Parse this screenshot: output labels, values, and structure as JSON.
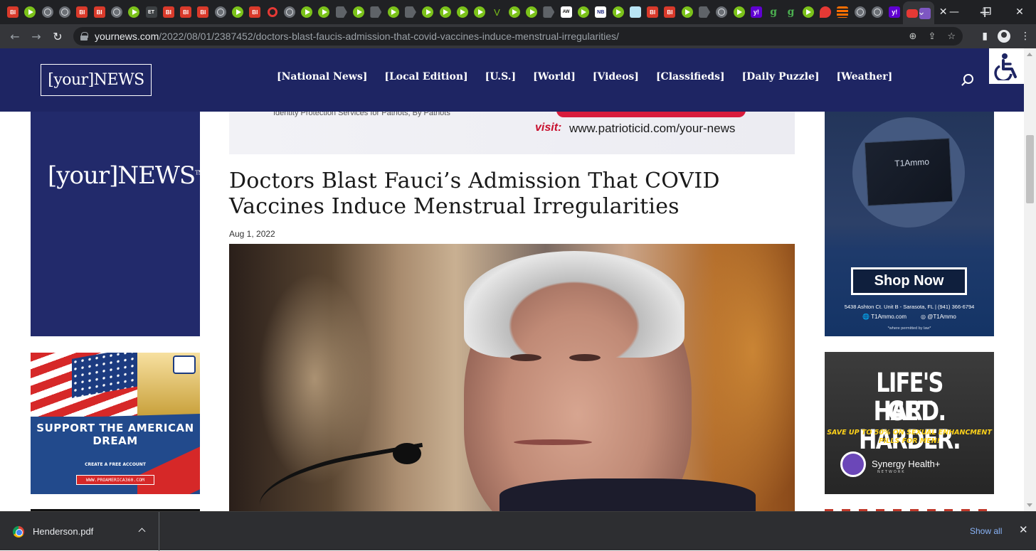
{
  "browser": {
    "tab_favicons": [
      "BI",
      "play",
      "globe",
      "globe",
      "BI",
      "BI",
      "globe",
      "play",
      "ET",
      "BI",
      "BI",
      "BI",
      "globe",
      "play",
      "BI",
      "red-circle",
      "globe",
      "play",
      "play",
      "flag",
      "play",
      "flag",
      "play",
      "flag",
      "play",
      "play",
      "play",
      "play",
      "V",
      "play",
      "play",
      "flag",
      "dark",
      "play",
      "NB",
      "play",
      "grid",
      "BI",
      "BI",
      "play",
      "flag",
      "globe",
      "play",
      "Y",
      "g",
      "g",
      "play",
      "pin",
      "stack",
      "globe",
      "globe",
      "Y"
    ],
    "active_tab_icons": [
      "youtube-icon",
      "mail-icon"
    ],
    "new_tab_label": "+",
    "url_host": "yournews.com",
    "url_path": "/2022/08/01/2387452/doctors-blast-faucis-admission-that-covid-vaccines-induce-menstrual-irregularities/"
  },
  "site": {
    "logo": "[your]NEWS",
    "nav": [
      "[National News]",
      "[Local Edition]",
      "[U.S.]",
      "[World]",
      "[Videos]",
      "[Classifieds]",
      "[Daily Puzzle]",
      "[Weather]"
    ]
  },
  "banner": {
    "tagline": "Identity Protection Services for Patriots, By Patriots",
    "visit_label": "visit:",
    "url": "www.patrioticid.com/your-news"
  },
  "article": {
    "headline": "Doctors Blast Fauci’s Admission That COVID Vaccines Induce Menstrual Irregularities",
    "date": "Aug 1, 2022"
  },
  "left_ads": {
    "logo": "[your]NEWS",
    "logo_tm": "TM",
    "american_dream": {
      "headline": "SUPPORT THE AMERICAN DREAM",
      "sub": "CREATE A FREE ACCOUNT",
      "url": "WWW.PROAMERICA360.COM"
    }
  },
  "right_ads": {
    "ammo": {
      "brand": "T1Ammo",
      "button": "Shop Now",
      "address": "5438 Ashton Ct. Unit B - Sarasota, FL | (941) 366-6794",
      "site": "T1Ammo.com",
      "social": "@T1Ammo",
      "legal": "*where permitted by law*"
    },
    "synergy": {
      "line1": "LIFE'S HARD.",
      "line2": "GET HARDER.",
      "offer": "SAVE UP TO 50% ON SEXUAL ENHANCMENT PILLS FOR MEN!",
      "brand": "Synergy Health+",
      "network": "NETWORK"
    }
  },
  "downloads": {
    "file": "Henderson.pdf",
    "show_all": "Show all"
  }
}
